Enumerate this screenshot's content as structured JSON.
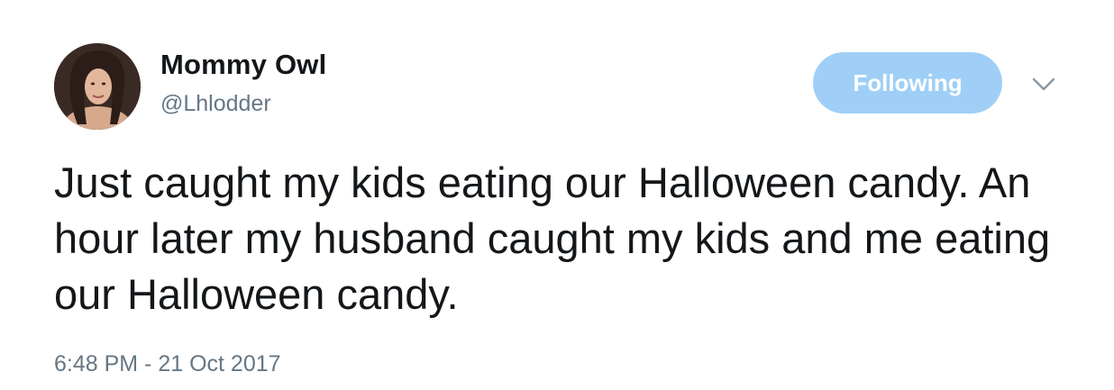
{
  "tweet": {
    "display_name": "Mommy Owl",
    "handle": "@Lhlodder",
    "follow_button_label": "Following",
    "text": "Just caught my kids eating our Halloween candy. An hour later my husband caught my kids and me eating our Halloween candy.",
    "timestamp": "6:48 PM - 21 Oct 2017",
    "avatar_icon": "profile-photo",
    "menu_icon": "chevron-down-icon"
  },
  "colors": {
    "text": "#14171a",
    "secondary_text": "#657786",
    "follow_button_bg": "#9fcff6",
    "follow_button_text": "#ffffff"
  }
}
